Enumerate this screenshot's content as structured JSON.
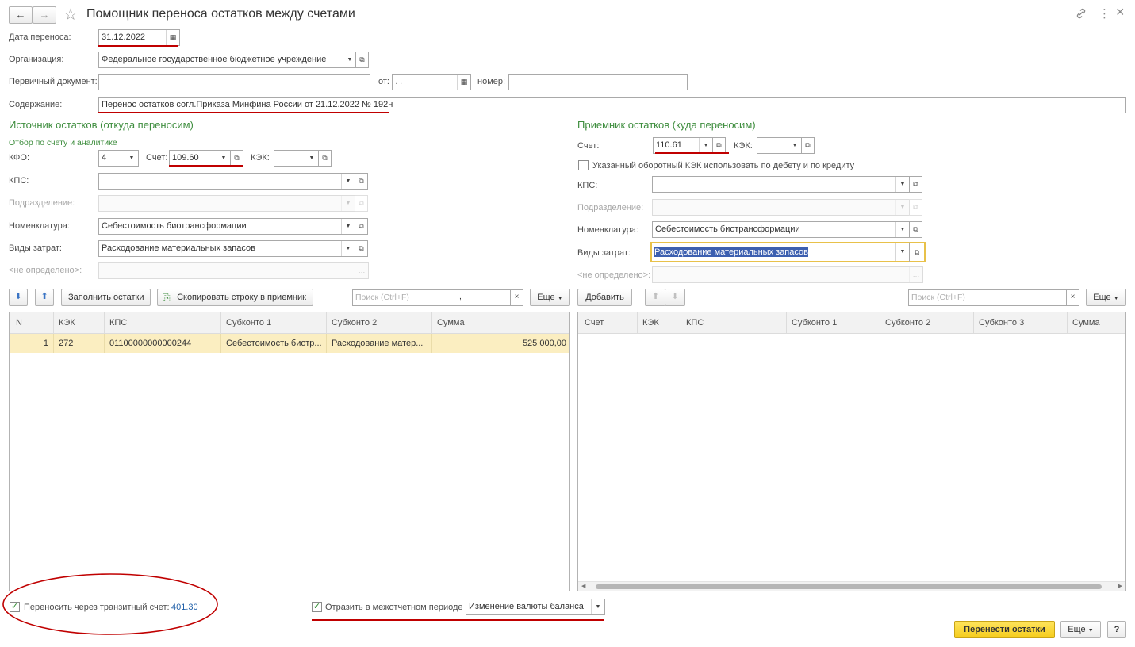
{
  "window": {
    "title": "Помощник переноса остатков между счетами",
    "back_icon": "←",
    "forward_icon": "→",
    "star_icon": "☆",
    "link_icon": "🔗",
    "more_icon": "⋮",
    "close_icon": "×"
  },
  "header": {
    "date_label": "Дата переноса:",
    "date_value": "31.12.2022",
    "org_label": "Организация:",
    "org_value": "Федеральное государственное бюджетное учреждение",
    "doc_label": "Первичный документ:",
    "doc_value": "",
    "doc_date_label": "от:",
    "doc_date_value": " .  .",
    "doc_num_label": "номер:",
    "doc_num_value": "",
    "content_label": "Содержание:",
    "content_value": "Перенос остатков согл.Приказа Минфина России от 21.12.2022 № 192н"
  },
  "source": {
    "title": "Источник остатков (откуда переносим)",
    "subtitle": "Отбор по счету и аналитике",
    "kfo_label": "КФО:",
    "kfo_value": "4",
    "account_label": "Счет:",
    "account_value": "109.60",
    "kek_label": "КЭК:",
    "kek_value": "",
    "kps_label": "КПС:",
    "kps_value": "",
    "division_label": "Подразделение:",
    "division_value": "",
    "nomenclature_label": "Номенклатура:",
    "nomenclature_value": "Себестоимость биотрансформации",
    "cost_type_label": "Виды затрат:",
    "cost_type_value": "Расходование материальных запасов",
    "undefined_label": "<не определено>:",
    "undefined_value": "",
    "fill_button": "Заполнить остатки",
    "copy_button": "Скопировать строку в приемник",
    "search_placeholder": "Поиск (Ctrl+F)",
    "search_value": ",",
    "more_button": "Еще",
    "columns": [
      "N",
      "КЭК",
      "КПС",
      "Субконто 1",
      "Субконто 2",
      "Сумма"
    ],
    "rows": [
      {
        "n": "1",
        "kek": "272",
        "kps": "01100000000000244",
        "sub1": "Себестоимость биотр...",
        "sub2": "Расходование матер...",
        "sum": "525 000,00"
      }
    ]
  },
  "target": {
    "title": "Приемник остатков (куда переносим)",
    "account_label": "Счет:",
    "account_value": "110.61",
    "kek_label": "КЭК:",
    "kek_value": "",
    "use_kek_label": "Указанный оборотный КЭК использовать по дебету и по кредиту",
    "use_kek_checked": false,
    "kps_label": "КПС:",
    "kps_value": "",
    "division_label": "Подразделение:",
    "division_value": "",
    "nomenclature_label": "Номенклатура:",
    "nomenclature_value": "Себестоимость биотрансформации",
    "cost_type_label": "Виды затрат:",
    "cost_type_value": "Расходование материальных запасов",
    "undefined_label": "<не определено>:",
    "undefined_value": "",
    "add_button": "Добавить",
    "search_placeholder": "Поиск (Ctrl+F)",
    "more_button": "Еще",
    "columns": [
      "Счет",
      "КЭК",
      "КПС",
      "Субконто 1",
      "Субконто 2",
      "Субконто 3",
      "Сумма"
    ]
  },
  "footer": {
    "transit_label": "Переносить через транзитный счет:",
    "transit_checked": true,
    "transit_account": "401.30",
    "interperiod_label": "Отразить в межотчетном периоде",
    "interperiod_checked": true,
    "interperiod_value": "Изменение валюты баланса",
    "submit_button": "Перенести остатки",
    "more_button": "Еще",
    "help_button": "?"
  },
  "colors": {
    "accent_green": "#3f8e3f",
    "annotation_red": "#c00000",
    "primary_yellow": "#f5cc1c",
    "selected_row": "#fbeec1"
  }
}
